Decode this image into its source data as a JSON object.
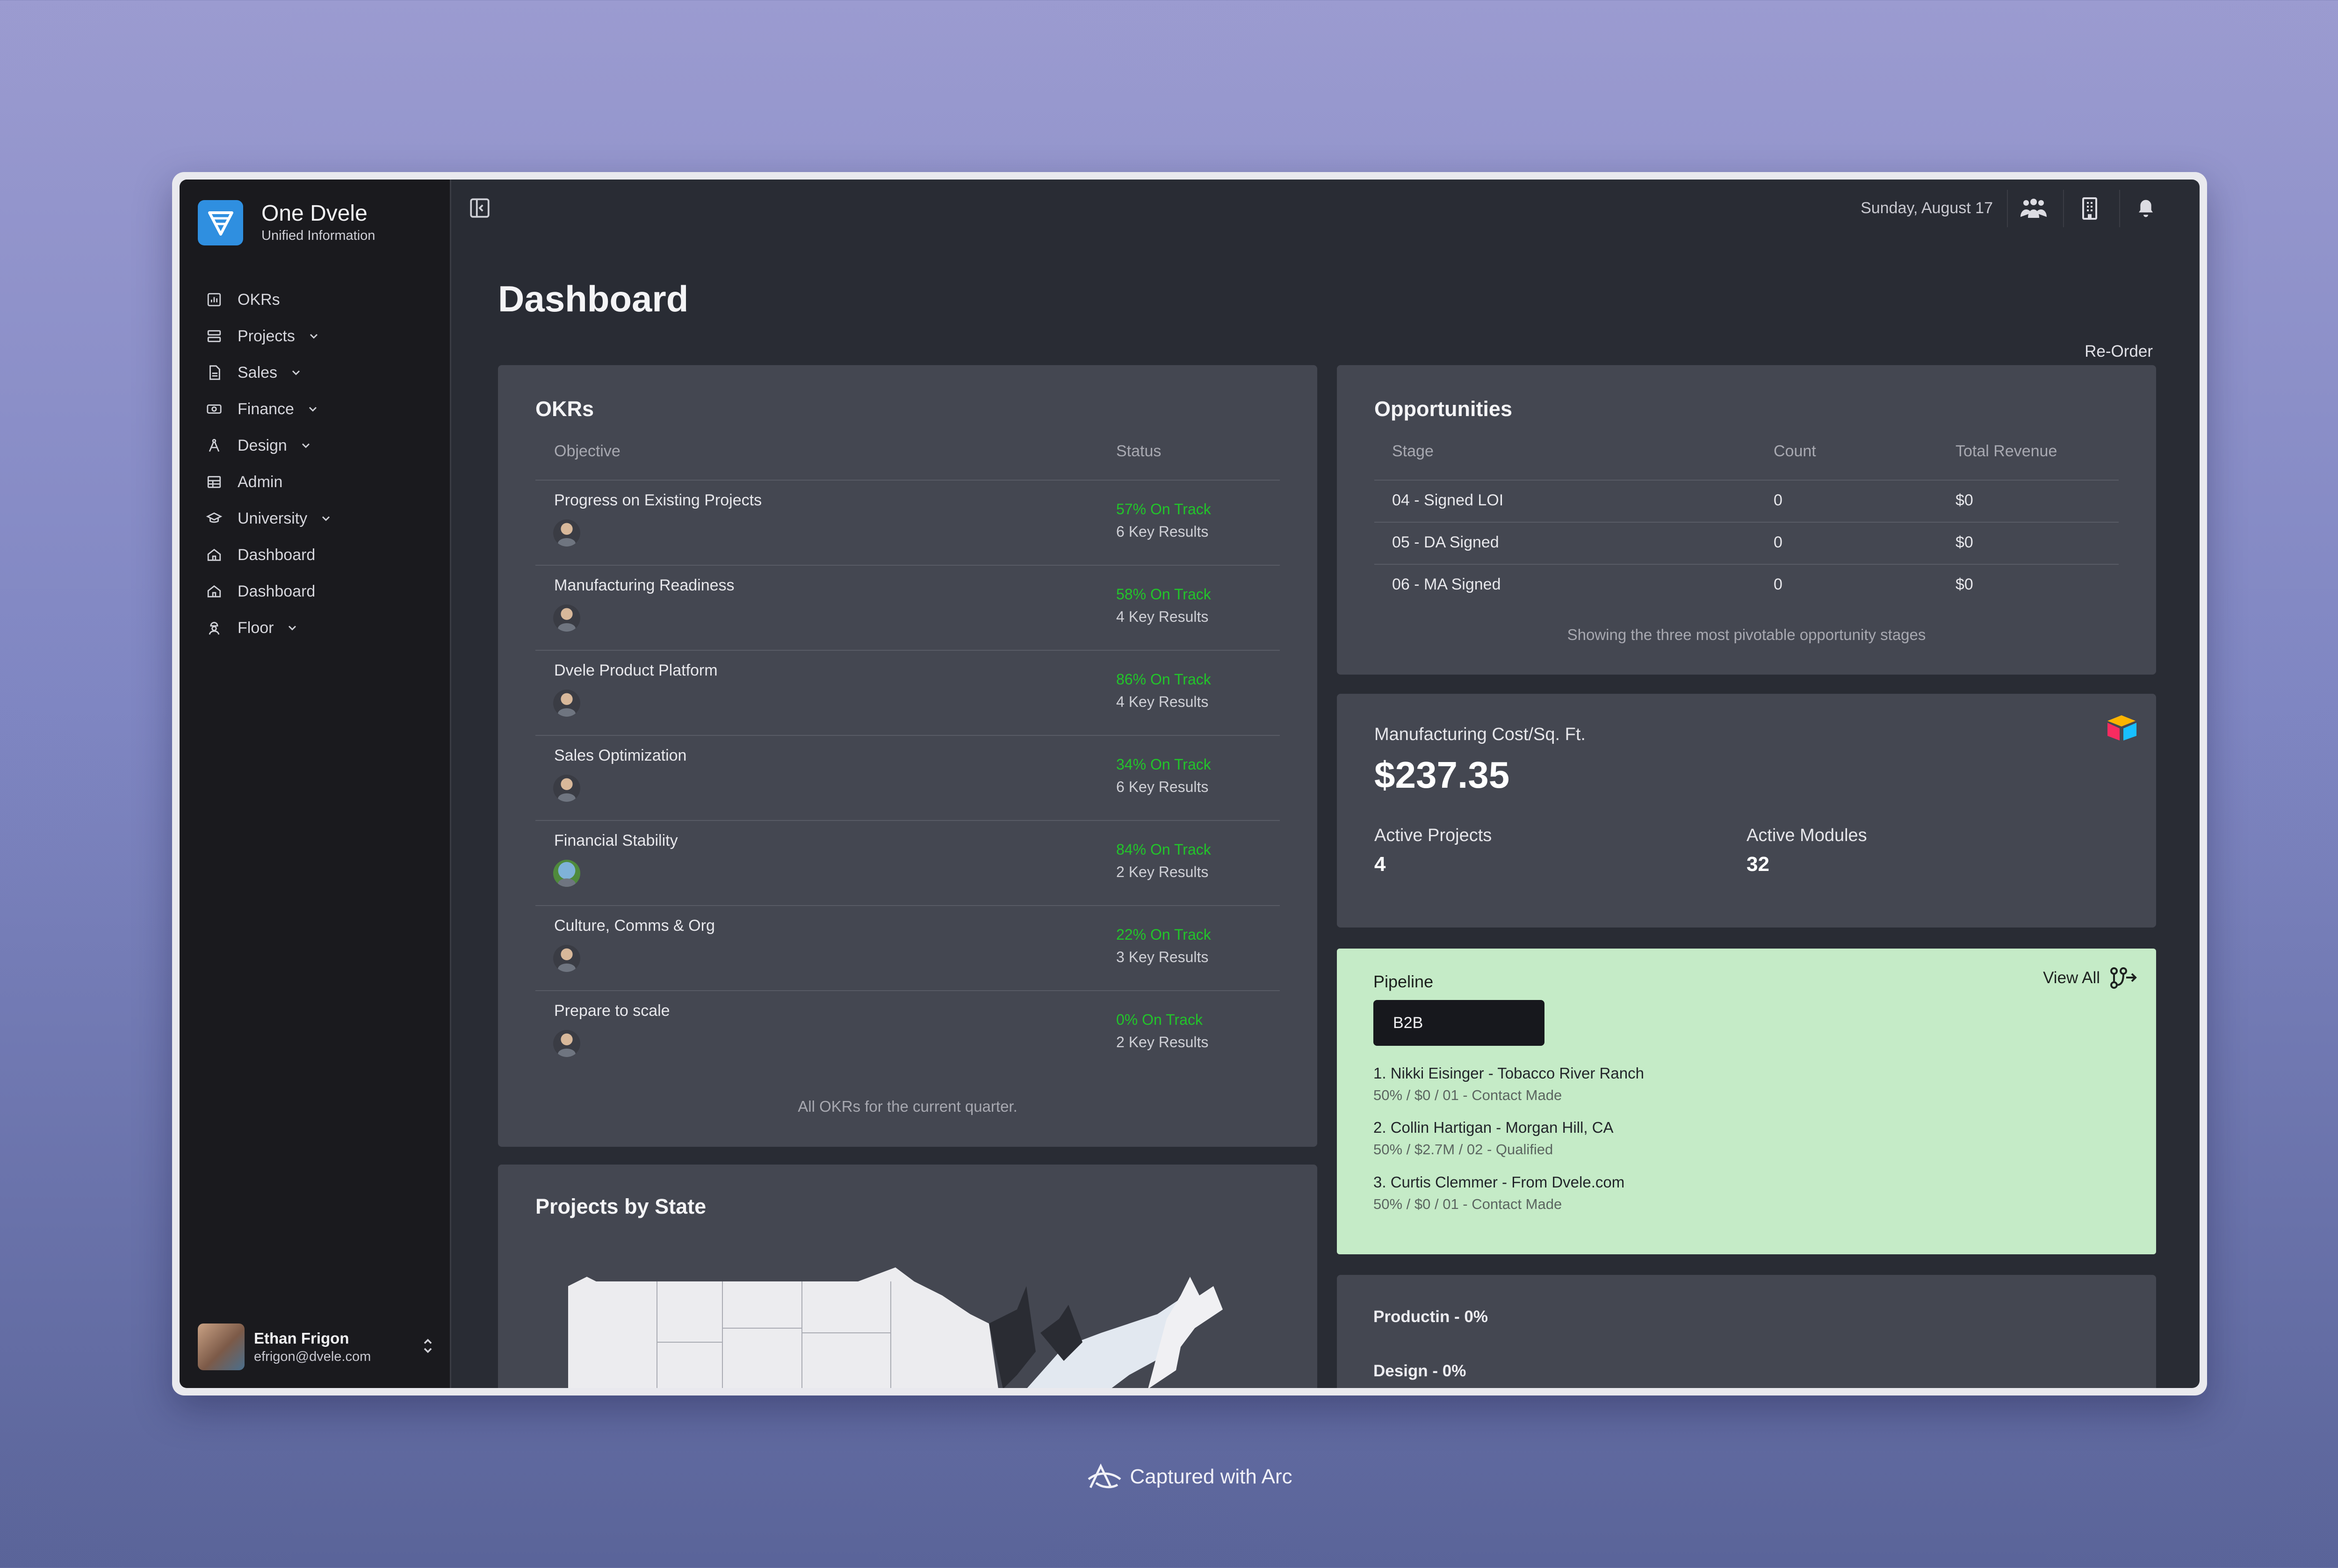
{
  "sidebar": {
    "brand_name": "One Dvele",
    "brand_sub": "Unified Information",
    "items": [
      {
        "label": "OKRs",
        "icon": "chart-box-icon",
        "has_chevron": false
      },
      {
        "label": "Projects",
        "icon": "projects-icon",
        "has_chevron": true
      },
      {
        "label": "Sales",
        "icon": "document-icon",
        "has_chevron": true
      },
      {
        "label": "Finance",
        "icon": "cash-icon",
        "has_chevron": true
      },
      {
        "label": "Design",
        "icon": "compass-icon",
        "has_chevron": true
      },
      {
        "label": "Admin",
        "icon": "table-icon",
        "has_chevron": false
      },
      {
        "label": "University",
        "icon": "graduation-cap-icon",
        "has_chevron": true
      },
      {
        "label": "Dashboard",
        "icon": "home-icon",
        "has_chevron": false
      },
      {
        "label": "Dashboard",
        "icon": "home-icon",
        "has_chevron": false
      },
      {
        "label": "Floor",
        "icon": "worker-icon",
        "has_chevron": true
      }
    ],
    "user": {
      "name": "Ethan Frigon",
      "email": "efrigon@dvele.com"
    }
  },
  "topbar": {
    "date": "Sunday, August 17"
  },
  "page": {
    "title": "Dashboard",
    "reorder_label": "Re-Order"
  },
  "okrs": {
    "title": "OKRs",
    "col_objective": "Objective",
    "col_status": "Status",
    "rows": [
      {
        "objective": "Progress on Existing Projects",
        "pct": "57% On Track",
        "key_results": "6 Key Results"
      },
      {
        "objective": "Manufacturing Readiness",
        "pct": "58% On Track",
        "key_results": "4 Key Results"
      },
      {
        "objective": "Dvele Product Platform",
        "pct": "86% On Track",
        "key_results": "4 Key Results"
      },
      {
        "objective": "Sales Optimization",
        "pct": "34% On Track",
        "key_results": "6 Key Results"
      },
      {
        "objective": "Financial Stability",
        "pct": "84% On Track",
        "key_results": "2 Key Results"
      },
      {
        "objective": "Culture, Comms & Org",
        "pct": "22% On Track",
        "key_results": "3 Key Results"
      },
      {
        "objective": "Prepare to scale",
        "pct": "0% On Track",
        "key_results": "2 Key Results"
      }
    ],
    "footer": "All OKRs for the current quarter."
  },
  "opportunities": {
    "title": "Opportunities",
    "col_stage": "Stage",
    "col_count": "Count",
    "col_revenue": "Total Revenue",
    "rows": [
      {
        "stage": "04 - Signed LOI",
        "count": "0",
        "revenue": "$0"
      },
      {
        "stage": "05 - DA Signed",
        "count": "0",
        "revenue": "$0"
      },
      {
        "stage": "06 - MA Signed",
        "count": "0",
        "revenue": "$0"
      }
    ],
    "footer": "Showing the three most pivotable opportunity stages"
  },
  "manufacturing": {
    "label": "Manufacturing Cost/Sq. Ft.",
    "value": "$237.35",
    "active_projects_label": "Active Projects",
    "active_projects_value": "4",
    "active_modules_label": "Active Modules",
    "active_modules_value": "32"
  },
  "pipeline": {
    "title": "Pipeline",
    "view_all": "View All",
    "selected": "B2B",
    "items": [
      {
        "title": "1. Nikki Eisinger - Tobacco River Ranch",
        "sub": "50% / $0 / 01 - Contact Made"
      },
      {
        "title": "2. Collin Hartigan - Morgan Hill, CA",
        "sub": "50% / $2.7M / 02 - Qualified"
      },
      {
        "title": "3. Curtis Clemmer - From Dvele.com",
        "sub": "50% / $0 / 01 - Contact Made"
      }
    ]
  },
  "projects_by_state": {
    "title": "Projects by State"
  },
  "progress": {
    "productin": "Productin - 0%",
    "design": "Design - 0%"
  },
  "caption": "Captured with Arc",
  "colors": {
    "accent": "#2f8fe0",
    "on_track": "#22c52a",
    "pipeline_bg": "#c5ebc7"
  }
}
